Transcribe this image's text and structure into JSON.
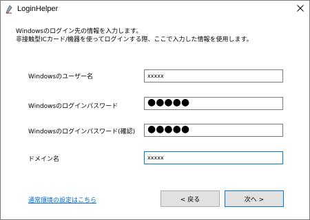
{
  "window": {
    "title": "LoginHelper",
    "app_icon": "pen-icon",
    "close_icon": "close-icon"
  },
  "description": {
    "line1": "Windowsのログイン先の情報を入力します。",
    "line2": "非接触型ICカード/機器を使ってログインする際、ここで入力した情報を使用します。"
  },
  "form": {
    "username": {
      "label": "Windowsのユーザー名",
      "value": "xxxxx"
    },
    "password": {
      "label": "Windowsのログインパスワード",
      "value": "●●●●●"
    },
    "password_confirm": {
      "label": "Windowsのログインパスワード(確認)",
      "value": "●●●●●"
    },
    "domain": {
      "label": "ドメイン名",
      "value": "xxxxx"
    }
  },
  "footer": {
    "settings_link": "通常環境の設定はこちら",
    "back_button": "< 戻る",
    "next_button": "次へ >"
  },
  "colors": {
    "focus_border": "#0078d7",
    "link": "#0066cc",
    "button_bg": "#e1e1e1"
  }
}
